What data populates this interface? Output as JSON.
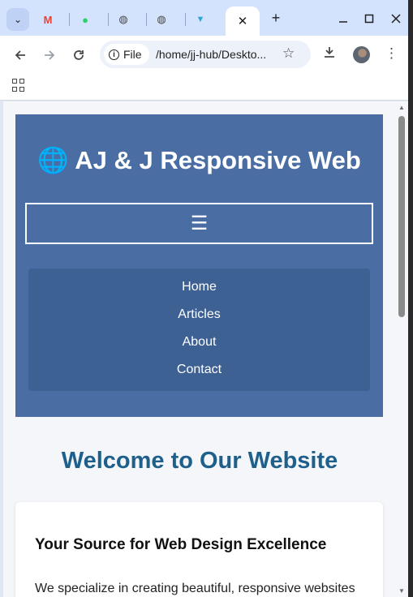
{
  "browser": {
    "tabs": [
      {
        "icon": "gmail-icon",
        "glyph": "M",
        "color": "#ea4335"
      },
      {
        "icon": "whatsapp-icon",
        "glyph": "●",
        "color": "#25d366"
      },
      {
        "icon": "globe-icon",
        "glyph": "◍",
        "color": "#474747"
      },
      {
        "icon": "globe-icon",
        "glyph": "◍",
        "color": "#474747"
      },
      {
        "icon": "app-icon",
        "glyph": "▼",
        "color": "#2aa9d8"
      }
    ],
    "active_tab_close": "✕",
    "new_tab": "+",
    "chip_label": "File",
    "url": "/home/jj-hub/Deskto..."
  },
  "page": {
    "header": {
      "globe_glyph": "🌐",
      "title": "AJ & J Responsive Web",
      "menu_toggle": "☰",
      "nav": [
        "Home",
        "Articles",
        "About",
        "Contact"
      ]
    },
    "welcome_heading": "Welcome to Our Website",
    "card": {
      "title": "Your Source for Web Design Excellence",
      "text": "We specialize in creating beautiful, responsive websites"
    }
  },
  "colors": {
    "header_bg": "#4a6ea4",
    "nav_bg": "#3d6193",
    "heading": "#1f5f8b",
    "page_bg": "#f4f6f9"
  }
}
